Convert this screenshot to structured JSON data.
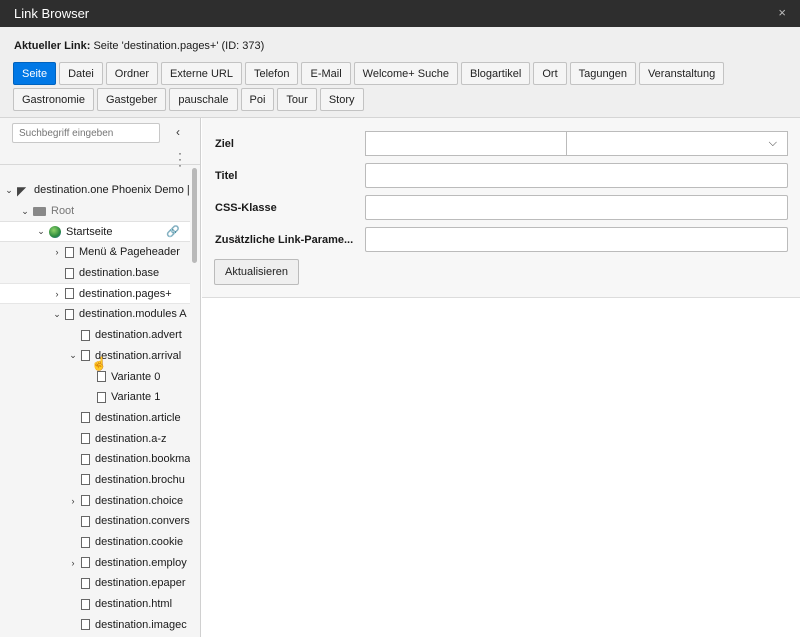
{
  "window": {
    "title": "Link Browser",
    "close_label": "×"
  },
  "current_link": {
    "label": "Aktueller Link:",
    "value": "Seite 'destination.pages+' (ID: 373)"
  },
  "tabs_row1": [
    "Seite",
    "Datei",
    "Ordner",
    "Externe URL",
    "Telefon",
    "E-Mail",
    "Welcome+ Suche",
    "Blogartikel",
    "Ort",
    "Tagungen",
    "Veranstaltung"
  ],
  "tabs_row2": [
    "Gastronomie",
    "Gastgeber",
    "pauschale",
    "Poi",
    "Tour",
    "Story"
  ],
  "active_tab": "Seite",
  "sidebar": {
    "search_placeholder": "Suchbegriff eingeben",
    "collapse_icon": "chevron-left-icon",
    "more_icon": "ellipsis-vertical-icon"
  },
  "tree": [
    {
      "label": "destination.one Phoenix Demo |",
      "depth": 0,
      "expanded": true,
      "icon": "typo3-icon"
    },
    {
      "label": "Root",
      "depth": 1,
      "expanded": true,
      "icon": "folder-icon"
    },
    {
      "label": "Startseite",
      "depth": 2,
      "expanded": true,
      "icon": "globe-icon",
      "selected": true
    },
    {
      "label": "Menü & Pageheader",
      "depth": 3,
      "expandable": true,
      "icon": "page-icon"
    },
    {
      "label": "destination.base",
      "depth": 3,
      "icon": "page-icon"
    },
    {
      "label": "destination.pages+",
      "depth": 3,
      "expandable": true,
      "icon": "page-icon",
      "highlighted": true
    },
    {
      "label": "destination.modules A",
      "depth": 3,
      "expanded": true,
      "icon": "page-icon"
    },
    {
      "label": "destination.advert",
      "depth": 4,
      "icon": "page-icon"
    },
    {
      "label": "destination.arrival",
      "depth": 4,
      "expanded": true,
      "icon": "page-icon"
    },
    {
      "label": "Variante 0",
      "depth": 5,
      "icon": "page-icon"
    },
    {
      "label": "Variante 1",
      "depth": 5,
      "icon": "page-icon"
    },
    {
      "label": "destination.article",
      "depth": 4,
      "icon": "page-icon"
    },
    {
      "label": "destination.a-z",
      "depth": 4,
      "icon": "page-icon"
    },
    {
      "label": "destination.bookma",
      "depth": 4,
      "icon": "page-icon"
    },
    {
      "label": "destination.brochu",
      "depth": 4,
      "icon": "page-icon"
    },
    {
      "label": "destination.choice",
      "depth": 4,
      "expandable": true,
      "icon": "page-icon"
    },
    {
      "label": "destination.convers",
      "depth": 4,
      "icon": "page-icon"
    },
    {
      "label": "destination.cookie",
      "depth": 4,
      "icon": "page-icon"
    },
    {
      "label": "destination.employ",
      "depth": 4,
      "expandable": true,
      "icon": "page-icon"
    },
    {
      "label": "destination.epaper",
      "depth": 4,
      "icon": "page-icon"
    },
    {
      "label": "destination.html",
      "depth": 4,
      "icon": "page-icon"
    },
    {
      "label": "destination.imagec",
      "depth": 4,
      "icon": "page-icon"
    }
  ],
  "form": {
    "target_label": "Ziel",
    "target_value": "",
    "target_select_value": "",
    "title_label": "Titel",
    "title_value": "",
    "css_label": "CSS-Klasse",
    "css_value": "",
    "params_label": "Zusätzliche Link-Parame...",
    "params_value": "",
    "update_button": "Aktualisieren"
  },
  "colors": {
    "accent": "#0078e6",
    "titlebar": "#2e2e2e"
  }
}
